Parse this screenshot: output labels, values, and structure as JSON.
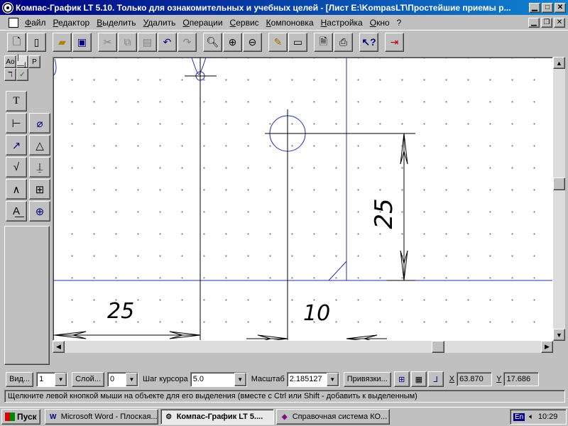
{
  "window": {
    "title": "Компас-График LT 5.10. Только для ознакомительных и учебных целей - [Лист E:\\KompasLT\\Простейшие приемы р..."
  },
  "menu": {
    "items": [
      "Файл",
      "Редактор",
      "Выделить",
      "Удалить",
      "Операции",
      "Сервис",
      "Компоновка",
      "Настройка",
      "Окно",
      "?"
    ]
  },
  "toolbar": {
    "buttons": [
      "new-sheet-icon",
      "new-fragment-icon",
      "open-icon",
      "save-icon",
      "cut-icon",
      "copy-icon",
      "paste-icon",
      "undo-icon",
      "redo-icon",
      "zoom-icon",
      "zoom-in-icon",
      "zoom-out-icon",
      "pan-icon",
      "refresh-icon",
      "preview-icon",
      "print-icon",
      "help-pointer-icon",
      "exit-icon"
    ]
  },
  "tool_panel": {
    "modes": [
      "Ао",
      "|—|",
      "Р"
    ],
    "tools": [
      "text-icon",
      "linear-dimension-icon",
      "diameter-icon",
      "radius-dimension-icon",
      "angle-dimension-icon",
      "roughness-icon",
      "datum-icon",
      "leader-icon",
      "table-icon",
      "position-label-icon",
      "center-mark-icon"
    ]
  },
  "drawing": {
    "dimensions": [
      "25",
      "10",
      "25"
    ]
  },
  "property_bar": {
    "view_button": "Вид...",
    "view_value": "1",
    "layer_button": "Слой...",
    "layer_value": "0",
    "step_label": "Шаг курсора",
    "step_value": "5.0",
    "scale_label": "Масштаб",
    "scale_value": "2.185127",
    "snaps_button": "Привязки...",
    "x_label": "X",
    "x_value": "63.870",
    "y_label": "Y",
    "y_value": "17.686"
  },
  "status": {
    "hint": "Щелкните левой кнопкой мыши на объекте для его выделения (вместе с Ctrl или Shift - добавить к выделенным)"
  },
  "taskbar": {
    "start": "Пуск",
    "tasks": [
      {
        "label": "Microsoft Word - Плоская...",
        "icon": "W",
        "active": false
      },
      {
        "label": "Компас-График LT 5....",
        "icon": "⚙",
        "active": true
      },
      {
        "label": "Справочная система КО...",
        "icon": "◈",
        "active": false
      }
    ],
    "lang": "En",
    "clock": "10:29"
  }
}
